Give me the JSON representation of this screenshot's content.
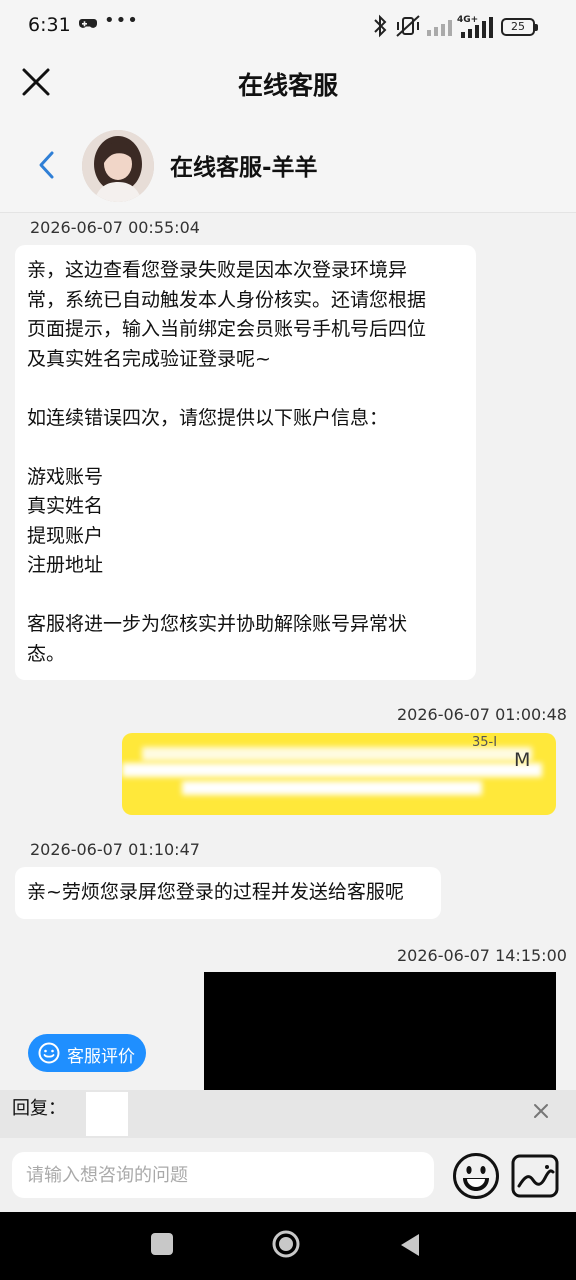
{
  "status_bar": {
    "time": "6:31",
    "dots": "•••",
    "network_label": "4G+",
    "battery_level": "25"
  },
  "header": {
    "title": "在线客服"
  },
  "agent": {
    "name": "在线客服-羊羊"
  },
  "messages": [
    {
      "timestamp": "2026-06-07 00:55:04",
      "side": "left",
      "lines": [
        "亲，这边查看您登录失败是因本次登录环境异",
        "常，系统已自动触发本人身份核实。还请您根据",
        "页面提示，输入当前绑定会员账号手机号后四位",
        "及真实姓名完成验证登录呢~",
        "",
        "如连续错误四次，请您提供以下账户信息：",
        "",
        "游戏账号",
        "真实姓名",
        "提现账户",
        "注册地址",
        "",
        "客服将进一步为您核实并协助解除账号异常状",
        "态。"
      ]
    },
    {
      "timestamp": "2026-06-07 01:00:48",
      "side": "right",
      "partial_text_1": "35-I",
      "partial_text_2": "M"
    },
    {
      "timestamp": "2026-06-07 01:10:47",
      "side": "left",
      "text": "亲~劳烦您录屏您登录的过程并发送给客服呢"
    },
    {
      "timestamp": "2026-06-07 14:15:00",
      "side": "right",
      "media": "video"
    }
  ],
  "rate_button": {
    "label": "客服评价"
  },
  "reply": {
    "label": "回复："
  },
  "input": {
    "placeholder": "请输入想咨询的问题",
    "value": ""
  },
  "icons": {
    "close": "close-icon",
    "back": "chevron-left-icon",
    "emoji": "emoji-icon",
    "image": "image-icon"
  },
  "colors": {
    "accent": "#1f8fff",
    "own_bubble": "#ffe83a"
  }
}
